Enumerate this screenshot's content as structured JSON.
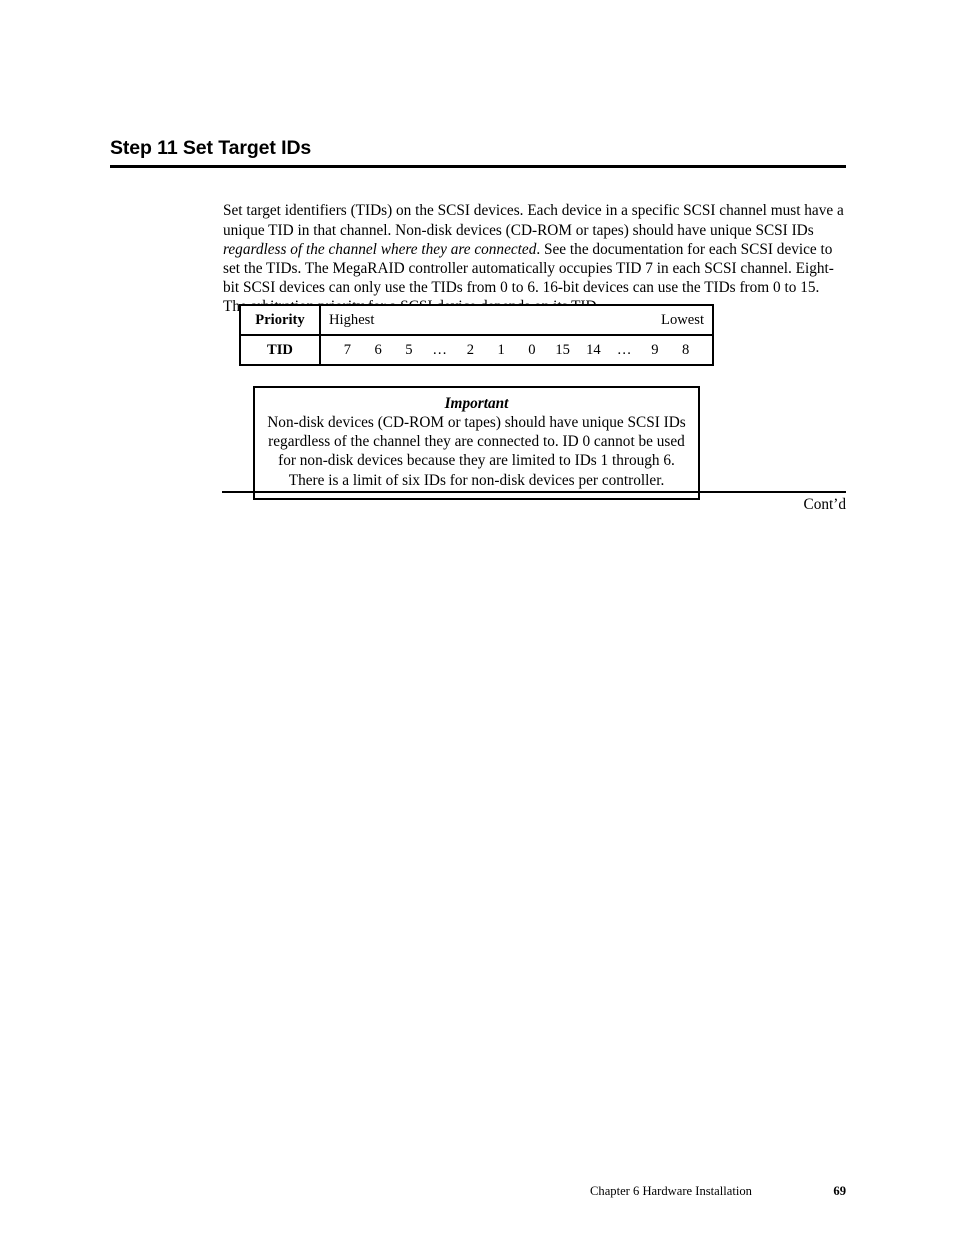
{
  "heading": {
    "title": "Step 11 Set Target IDs"
  },
  "body": {
    "paragraph_part1": "Set target identifiers (TIDs) on the SCSI devices. Each device in a specific SCSI channel must have a unique TID in that channel. Non-disk devices (CD-ROM or tapes) should have unique SCSI IDs ",
    "paragraph_emphasis": "regardless of the channel where they are connected",
    "paragraph_part2": ". See the documentation for each SCSI device to set the TIDs. The MegaRAID controller automatically occupies TID 7 in each SCSI channel. Eight-bit SCSI devices can only use the TIDs from 0 to 6. 16-bit devices can use the TIDs from 0 to 15. The arbitration priority for a SCSI device depends on its TID."
  },
  "tid_table": {
    "row_labels": {
      "priority": "Priority",
      "tid": "TID"
    },
    "priority_extremes": {
      "highest": "Highest",
      "lowest": "Lowest"
    },
    "tid_values": [
      "7",
      "6",
      "5",
      "…",
      "2",
      "1",
      "0",
      "15",
      "14",
      "…",
      "9",
      "8"
    ]
  },
  "important_box": {
    "title": "Important",
    "lines": [
      "Non-disk devices (CD-ROM or tapes) should have unique SCSI IDs",
      "regardless of the channel they are connected to. ID 0 cannot be used",
      "for non-disk devices because they are limited to IDs 1 through 6.",
      "There is a limit of six IDs for non-disk devices per controller."
    ]
  },
  "continuation": {
    "label": "Cont’d"
  },
  "footer": {
    "chapter": "Chapter 6 Hardware Installation",
    "page_number": "69"
  }
}
